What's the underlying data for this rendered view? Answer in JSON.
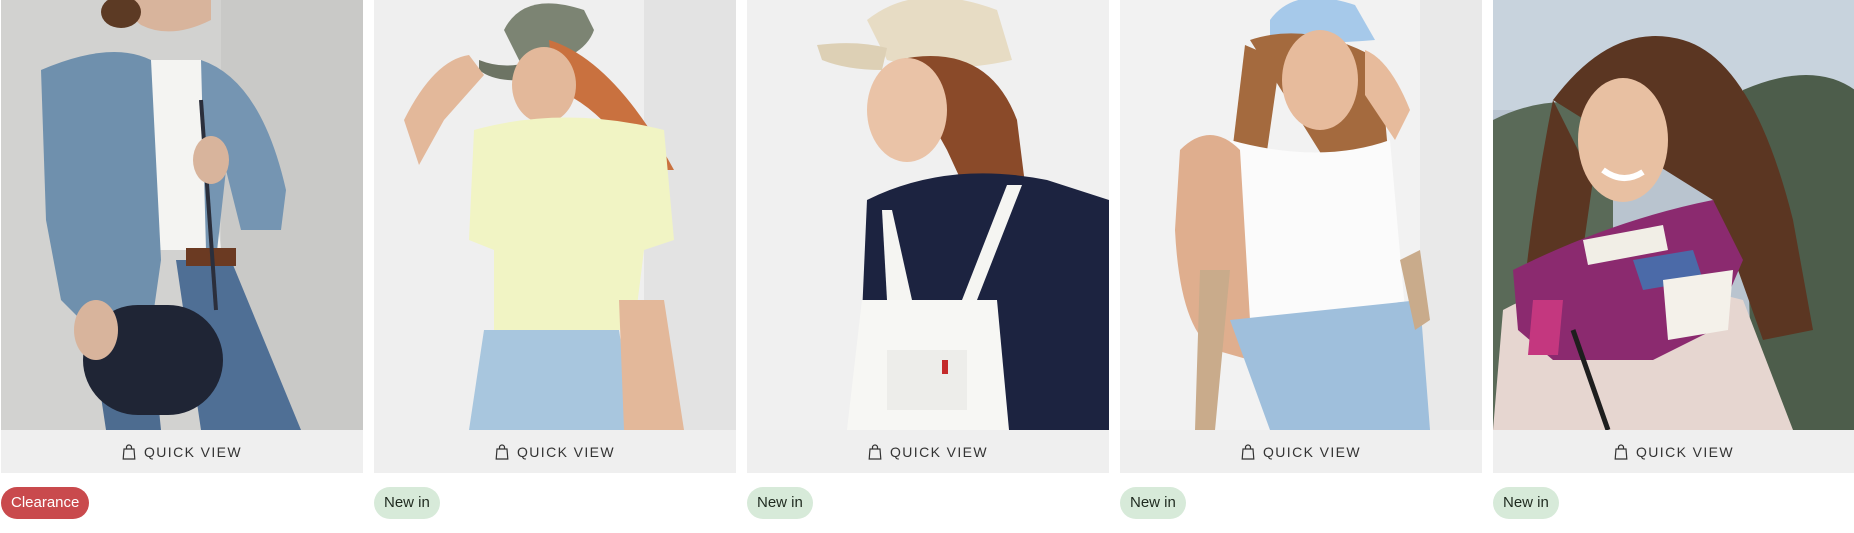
{
  "products": [
    {
      "badge": "Clearance",
      "badge_type": "clearance",
      "quick_view_label": "QUICK VIEW",
      "icon": "shopping-bag-icon"
    },
    {
      "badge": "New in",
      "badge_type": "new",
      "quick_view_label": "QUICK VIEW",
      "icon": "shopping-bag-icon"
    },
    {
      "badge": "New in",
      "badge_type": "new",
      "quick_view_label": "QUICK VIEW",
      "icon": "shopping-bag-icon"
    },
    {
      "badge": "New in",
      "badge_type": "new",
      "quick_view_label": "QUICK VIEW",
      "icon": "shopping-bag-icon"
    },
    {
      "badge": "New in",
      "badge_type": "new",
      "quick_view_label": "QUICK VIEW",
      "icon": "shopping-bag-icon"
    }
  ],
  "colors": {
    "clearance_badge": "#c94a4d",
    "new_badge": "#d7ead9",
    "quick_view_bar": "#efefef"
  }
}
